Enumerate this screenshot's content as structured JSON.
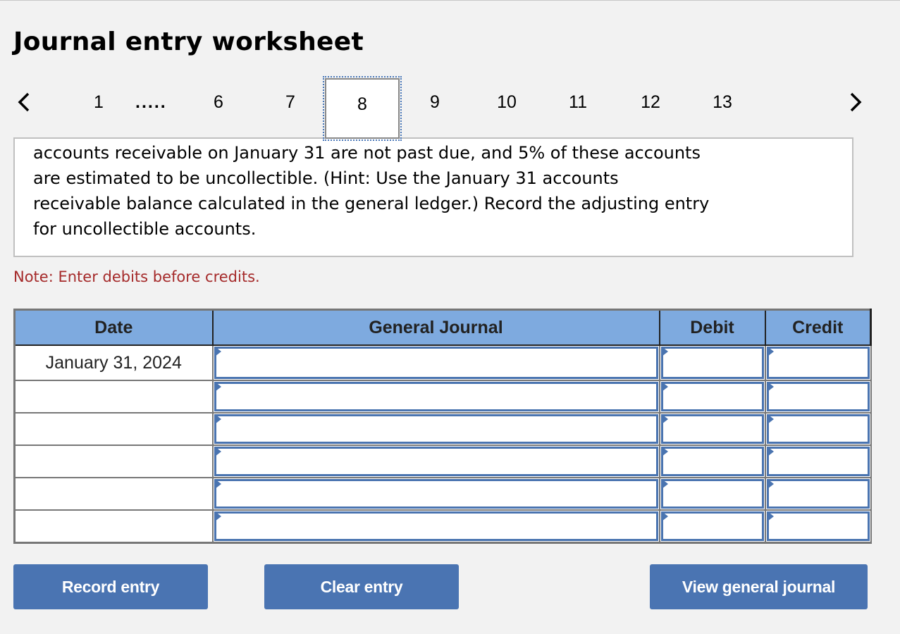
{
  "page": {
    "title": "Journal entry worksheet"
  },
  "pager": {
    "prev_icon": "chevron-left-icon",
    "next_icon": "chevron-right-icon",
    "first": "1",
    "ellipsis": ".....",
    "pages": [
      "6",
      "7",
      "8",
      "9",
      "10",
      "11",
      "12",
      "13"
    ],
    "current": "8"
  },
  "question": {
    "lines": [
      "accounts receivable on January 31 are not past due, and 5% of these accounts",
      "are estimated to be uncollectible. (Hint: Use the January 31 accounts",
      "receivable balance calculated in the general ledger.) Record the adjusting entry",
      "for uncollectible accounts."
    ]
  },
  "note": "Note: Enter debits before credits.",
  "journal": {
    "headers": {
      "date": "Date",
      "general_journal": "General Journal",
      "debit": "Debit",
      "credit": "Credit"
    },
    "rows": [
      {
        "date": "January 31, 2024",
        "account": "",
        "debit": "",
        "credit": ""
      },
      {
        "date": "",
        "account": "",
        "debit": "",
        "credit": ""
      },
      {
        "date": "",
        "account": "",
        "debit": "",
        "credit": ""
      },
      {
        "date": "",
        "account": "",
        "debit": "",
        "credit": ""
      },
      {
        "date": "",
        "account": "",
        "debit": "",
        "credit": ""
      },
      {
        "date": "",
        "account": "",
        "debit": "",
        "credit": ""
      }
    ]
  },
  "buttons": {
    "record": "Record entry",
    "clear": "Clear entry",
    "view": "View general journal"
  },
  "colors": {
    "header_bg": "#7eaadf",
    "button_bg": "#4a74b2",
    "note_text": "#a52a2a",
    "input_border": "#4a74b0"
  }
}
